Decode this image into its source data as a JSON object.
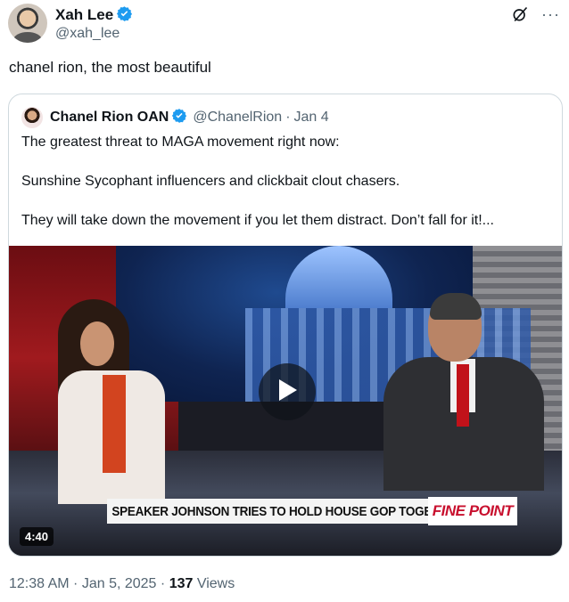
{
  "tweet": {
    "author_name": "Xah Lee",
    "author_handle": "@xah_lee",
    "text": "chanel rion, the most beautiful",
    "more_label": "···",
    "timestamp": "12:38 AM · Jan 5, 2025",
    "separator": "·",
    "views_count": "137",
    "views_label": "Views"
  },
  "quote": {
    "author_name": "Chanel Rion OAN",
    "author_handle": "@ChanelRion",
    "separator": "·",
    "date": "Jan 4",
    "line1": "The greatest threat to MAGA movement right now:",
    "line2": "Sunshine Sycophant influencers and clickbait clout chasers.",
    "line3": "They will take down the movement if you let them distract. Don’t fall for it!...",
    "video": {
      "duration": "4:40",
      "lower_third": "SPEAKER JOHNSON TRIES TO HOLD HOUSE GOP TOGETHER",
      "brand": "FINE POINT"
    }
  },
  "colors": {
    "text": "#0f1419",
    "secondary": "#536471",
    "verified": "#1d9bf0",
    "border": "#cfd9de"
  },
  "icons": {
    "verified": "verified-badge-icon",
    "grok": "grok-icon",
    "more": "more-icon",
    "play": "play-icon"
  }
}
